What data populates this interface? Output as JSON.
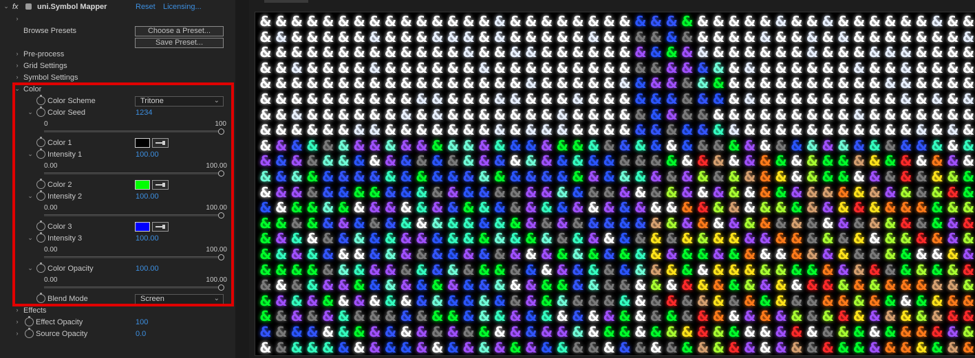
{
  "effect": {
    "fx_label": "fx",
    "name": "uni.Symbol Mapper",
    "reset": "Reset",
    "licensing": "Licensing..."
  },
  "presets": {
    "label": "Browse Presets",
    "choose": "Choose a Preset...",
    "save": "Save Preset..."
  },
  "groups": {
    "preprocess": "Pre-process",
    "grid": "Grid Settings",
    "symbol": "Symbol Settings",
    "color": "Color",
    "effects": "Effects"
  },
  "color": {
    "scheme_label": "Color Scheme",
    "scheme_value": "Tritone",
    "seed_label": "Color Seed",
    "seed_value": "1234",
    "seed_min": "0",
    "seed_max": "100",
    "seed_slider": 1.0,
    "color1_label": "Color 1",
    "color1_value": "#000000",
    "intensity1_label": "Intensity 1",
    "intensity1_value": "100.00",
    "intensity1_min": "0.00",
    "intensity1_max": "100.00",
    "intensity1_slider": 1.0,
    "color2_label": "Color 2",
    "color2_value": "#00ff00",
    "intensity2_label": "Intensity 2",
    "intensity2_value": "100.00",
    "intensity2_min": "0.00",
    "intensity2_max": "100.00",
    "intensity2_slider": 1.0,
    "color3_label": "Color 3",
    "color3_value": "#0000ff",
    "intensity3_label": "Intensity 3",
    "intensity3_value": "100.00",
    "intensity3_min": "0.00",
    "intensity3_max": "100.00",
    "intensity3_slider": 1.0,
    "opacity_label": "Color Opacity",
    "opacity_value": "100.00",
    "opacity_min": "0.00",
    "opacity_max": "100.00",
    "opacity_slider": 1.0,
    "blend_label": "Blend Mode",
    "blend_value": "Screen"
  },
  "bottom": {
    "effect_opacity_label": "Effect Opacity",
    "effect_opacity_value": "100",
    "source_opacity_label": "Source Opacity",
    "source_opacity_value": "0.0"
  },
  "viewer": {
    "glyph": "&",
    "highlight_color": "#e00000",
    "palette": [
      "#ffffff",
      "#e8f0ff",
      "#2a55ff",
      "#00ff2a",
      "#33ffc0",
      "#6fffd8",
      "#a050ff",
      "#ff7a1a",
      "#ffe31a",
      "#ff2a2a",
      "#d6a070",
      "#7a7a7a",
      "#3355ff",
      "#a8ff30"
    ]
  }
}
